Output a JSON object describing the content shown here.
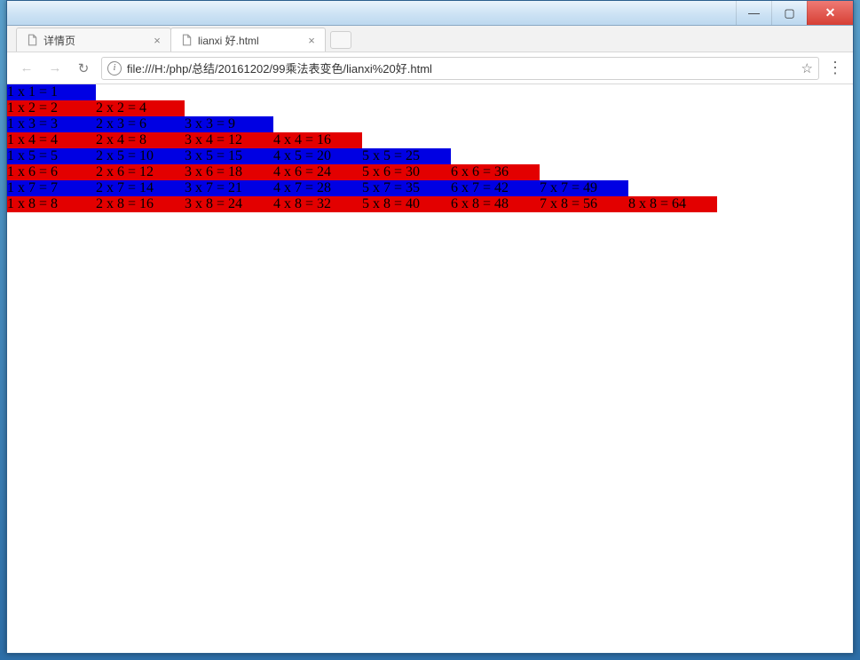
{
  "window": {
    "minimize_symbol": "—",
    "maximize_symbol": "▢",
    "close_symbol": "✕"
  },
  "tabs": [
    {
      "label": "详情页",
      "active": false
    },
    {
      "label": "lianxi 好.html",
      "active": true
    }
  ],
  "toolbar": {
    "back_symbol": "←",
    "forward_symbol": "→",
    "reload_symbol": "↻",
    "url_text": "file:///H:/php/总结/20161202/99乘法表变色/lianxi%20好.html",
    "star_symbol": "☆",
    "menu_symbol": "⋮"
  },
  "chart_data": {
    "type": "table",
    "title": "九九乘法表 (rows 1–8, alternating row colors)",
    "rows": [
      {
        "i": 1,
        "color": "blue",
        "cells": [
          "1 x 1 = 1"
        ]
      },
      {
        "i": 2,
        "color": "red",
        "cells": [
          "1 x 2 = 2",
          "2 x 2 = 4"
        ]
      },
      {
        "i": 3,
        "color": "blue",
        "cells": [
          "1 x 3 = 3",
          "2 x 3 = 6",
          "3 x 3 = 9"
        ]
      },
      {
        "i": 4,
        "color": "red",
        "cells": [
          "1 x 4 = 4",
          "2 x 4 = 8",
          "3 x 4 = 12",
          "4 x 4 = 16"
        ]
      },
      {
        "i": 5,
        "color": "blue",
        "cells": [
          "1 x 5 = 5",
          "2 x 5 = 10",
          "3 x 5 = 15",
          "4 x 5 = 20",
          "5 x 5 = 25"
        ]
      },
      {
        "i": 6,
        "color": "red",
        "cells": [
          "1 x 6 = 6",
          "2 x 6 = 12",
          "3 x 6 = 18",
          "4 x 6 = 24",
          "5 x 6 = 30",
          "6 x 6 = 36"
        ]
      },
      {
        "i": 7,
        "color": "blue",
        "cells": [
          "1 x 7 = 7",
          "2 x 7 = 14",
          "3 x 7 = 21",
          "4 x 7 = 28",
          "5 x 7 = 35",
          "6 x 7 = 42",
          "7 x 7 = 49"
        ]
      },
      {
        "i": 8,
        "color": "red",
        "cells": [
          "1 x 8 = 8",
          "2 x 8 = 16",
          "3 x 8 = 24",
          "4 x 8 = 32",
          "5 x 8 = 40",
          "6 x 8 = 48",
          "7 x 8 = 56",
          "8 x 8 = 64"
        ]
      }
    ],
    "colors": {
      "blue": "#0000e3",
      "red": "#e30000"
    }
  }
}
